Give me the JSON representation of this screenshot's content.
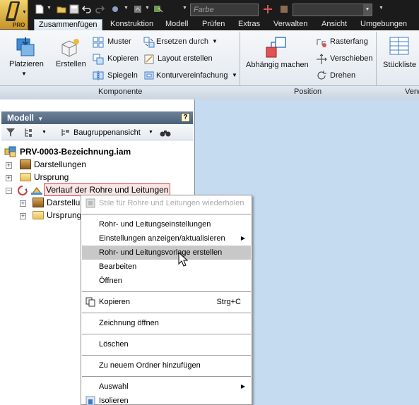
{
  "app": {
    "badge": "PRO"
  },
  "quick_access": {
    "color_placeholder": "Farbe"
  },
  "tabs": [
    {
      "label": "Zusammenfügen",
      "active": true
    },
    {
      "label": "Konstruktion"
    },
    {
      "label": "Modell"
    },
    {
      "label": "Prüfen"
    },
    {
      "label": "Extras"
    },
    {
      "label": "Verwalten"
    },
    {
      "label": "Ansicht"
    },
    {
      "label": "Umgebungen"
    }
  ],
  "ribbon": {
    "komponente": {
      "title": "Komponente",
      "platzieren": "Platzieren",
      "erstellen": "Erstellen",
      "muster": "Muster",
      "kopieren": "Kopieren",
      "spiegeln": "Spiegeln",
      "ersetzen": "Ersetzen durch",
      "layout": "Layout erstellen",
      "kontur": "Konturvereinfachung"
    },
    "position": {
      "title": "Position",
      "abhaengig": "Abhängig machen",
      "rasterfang": "Rasterfang",
      "verschieben": "Verschieben",
      "drehen": "Drehen"
    },
    "verwalten": {
      "title": "Verw",
      "stueckliste": "Stückliste"
    }
  },
  "browser": {
    "title": "Modell",
    "help": "?",
    "view_label": "Baugruppenansicht",
    "tree": {
      "root": "PRV-0003-Bezeichnung.iam",
      "darstellungen": "Darstellungen",
      "ursprung": "Ursprung",
      "verlauf": "Verlauf der Rohre und Leitungen",
      "sub_darstellungen": "Darstellung",
      "sub_ursprung": "Ursprung"
    }
  },
  "context_menu": {
    "stile": "Stile für Rohre und Leitungen wiederholen",
    "einstellungen": "Rohr- und Leitungseinstellungen",
    "anzeigen": "Einstellungen anzeigen/aktualisieren",
    "vorlage": "Rohr- und Leitungsvorlage erstellen",
    "bearbeiten": "Bearbeiten",
    "oeffnen": "Öffnen",
    "kopieren": "Kopieren",
    "kopieren_shortcut": "Strg+C",
    "zeichnung": "Zeichnung öffnen",
    "loeschen": "Löschen",
    "ordner": "Zu neuem Ordner hinzufügen",
    "auswahl": "Auswahl",
    "isolieren": "Isolieren"
  }
}
